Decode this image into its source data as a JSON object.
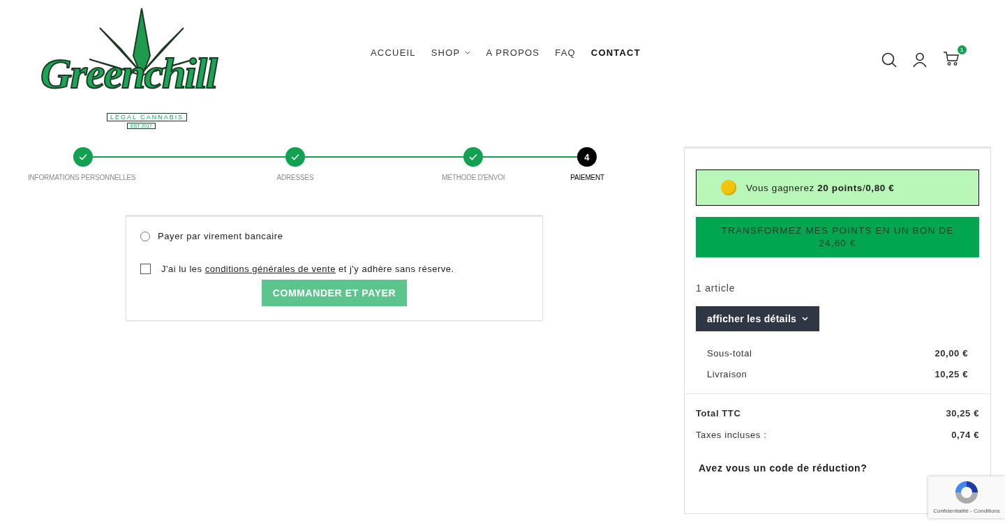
{
  "logo": {
    "name": "Greenchill",
    "tagline": "LEGAL CANNABIS",
    "established": "EST 2017"
  },
  "nav": [
    {
      "label": "ACCUEIL",
      "has_dropdown": false
    },
    {
      "label": "SHOP",
      "has_dropdown": true
    },
    {
      "label": "A PROPOS",
      "has_dropdown": false
    },
    {
      "label": "FAQ",
      "has_dropdown": false
    },
    {
      "label": "CONTACT",
      "has_dropdown": false
    }
  ],
  "cart_count": "1",
  "steps": [
    {
      "label": "INFORMATIONS PERSONNELLES",
      "completed": true,
      "selected": false
    },
    {
      "label": "ADRESSES",
      "completed": true,
      "selected": false
    },
    {
      "label": "MÉTHODE D'ENVOI",
      "completed": true,
      "selected": false
    },
    {
      "label": "PAIEMENT",
      "completed": false,
      "selected": true,
      "number": "4"
    }
  ],
  "payment": {
    "options": [
      {
        "label": "Payer par virement bancaire",
        "selected": false
      }
    ],
    "terms": {
      "before": "J'ai lu les ",
      "link": "conditions générales de vente",
      "after": " et j'y adhère sans réserve.",
      "checked": false
    },
    "submit": {
      "label": "COMMANDER ET PAYER",
      "disabled": true
    }
  },
  "summary": {
    "points": "Vous gagnerez **20 points**/**0,80 €**",
    "convert_button": "TRANSFORMEZ MES POINTS EN UN BON DE 24,60 €",
    "article_count": "1 article",
    "details_button": "afficher les détails",
    "lines": [
      {
        "label": "Sous-total",
        "value": "20,00 €"
      },
      {
        "label": "Livraison",
        "value": "10,25 €"
      }
    ],
    "totals": [
      {
        "label": "Total TTC",
        "value": "30,25 €"
      },
      {
        "label": "Taxes incluses :",
        "value": "0,74 €"
      }
    ],
    "discount_prompt": "Avez vous un code de réduction?"
  },
  "recaptcha": {
    "text": "Confidentialité - Conditions"
  }
}
